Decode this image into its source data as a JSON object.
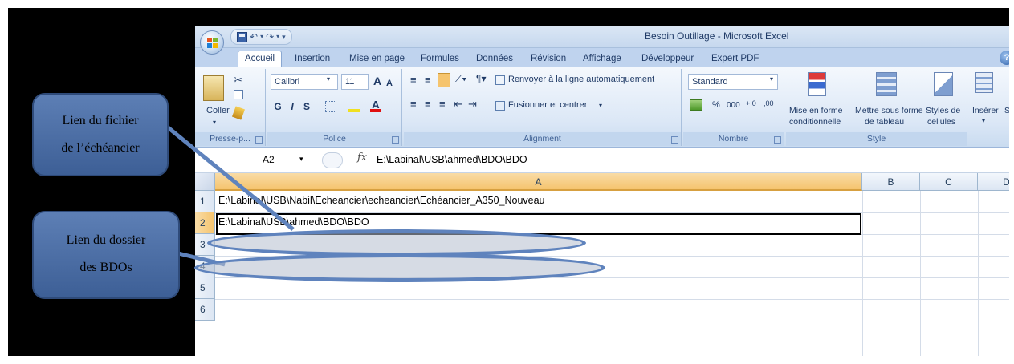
{
  "window": {
    "title": "Besoin Outillage - Microsoft Excel",
    "qat_undo": "↶",
    "qat_undo_arrow": "▾",
    "qat_redo": "↷",
    "qat_redo_arrow": "▾",
    "qat_customize": "▾"
  },
  "tabs": [
    "Accueil",
    "Insertion",
    "Mise en page",
    "Formules",
    "Données",
    "Révision",
    "Affichage",
    "Développeur",
    "Expert PDF"
  ],
  "ribbon": {
    "clipboard": {
      "paste_label": "Coller",
      "group_label": "Presse-p..."
    },
    "font": {
      "font_name": "Calibri",
      "font_size": "11",
      "grow": "A",
      "shrink": "A",
      "bold": "G",
      "italic": "I",
      "underline": "S",
      "group_label": "Police"
    },
    "alignment": {
      "wrap_label": "Renvoyer à la ligne automatiquement",
      "merge_label": "Fusionner et centrer",
      "group_label": "Alignment"
    },
    "number": {
      "format": "Standard",
      "percent": "%",
      "thousands": "000",
      "increase_decimal": "+,0",
      "decrease_decimal": ",00",
      "group_label": "Nombre"
    },
    "style": {
      "conditional_line1": "Mise en forme",
      "conditional_line2": "conditionnelle",
      "table_line1": "Mettre sous forme",
      "table_line2": "de tableau",
      "cell_styles_line1": "Styles de",
      "cell_styles_line2": "cellules",
      "group_label": "Style"
    },
    "cells": {
      "insert_label": "Insérer",
      "partial_label": "Su"
    }
  },
  "formula_bar": {
    "name_box": "A2",
    "fx": "fx",
    "formula": "E:\\Labinal\\USB\\ahmed\\BDO\\BDO"
  },
  "grid": {
    "columns": [
      "A",
      "B",
      "C",
      "D"
    ],
    "rows": [
      "1",
      "2",
      "3",
      "4",
      "5",
      "6"
    ],
    "cells": {
      "A1": "E:\\Labinal\\USB\\Nabil\\Echeancier\\echeancier\\Echéancier_A350_Nouveau",
      "A2": "E:\\Labinal\\USB\\ahmed\\BDO\\BDO"
    }
  },
  "annotations": {
    "callout1_line1": "Lien du fichier",
    "callout1_line2": "de l’échéancier",
    "callout2_line1": "Lien du dossier",
    "callout2_line2": "des BDOs"
  },
  "colors": {
    "callout_fill": "#4a6ca3",
    "ellipse_stroke": "#5f83bd",
    "selection": "#f5c46e"
  }
}
